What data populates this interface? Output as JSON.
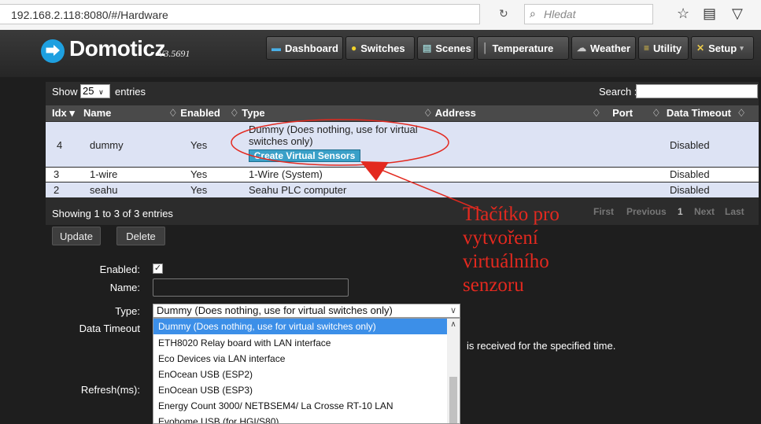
{
  "browser": {
    "url": "192.168.2.118:8080/#/Hardware",
    "reload_icon": "↻",
    "search_placeholder": "Hledat",
    "icons": [
      "reload-icon",
      "search-icon",
      "bookmark-star-icon",
      "reading-list-icon",
      "pocket-icon"
    ]
  },
  "app": {
    "logo_name": "Domoticz",
    "version": "V3.5691",
    "nav": [
      {
        "label": "Dashboard",
        "icon": "monitor-icon"
      },
      {
        "label": "Switches",
        "icon": "bulb-icon"
      },
      {
        "label": "Scenes",
        "icon": "scene-icon"
      },
      {
        "label": "Temperature",
        "icon": "thermometer-icon"
      },
      {
        "label": "Weather",
        "icon": "cloud-icon"
      },
      {
        "label": "Utility",
        "icon": "utility-icon"
      },
      {
        "label": "Setup",
        "icon": "tools-icon"
      }
    ]
  },
  "table": {
    "show_label": "Show",
    "entries_value": "25",
    "entries_label": "entries",
    "search_label": "Search :",
    "headers": {
      "idx": "Idx",
      "name": "Name",
      "enabled": "Enabled",
      "type": "Type",
      "address": "Address",
      "port": "Port",
      "data_timeout": "Data Timeout"
    },
    "rows": [
      {
        "idx": "4",
        "name": "dummy",
        "enabled": "Yes",
        "type": "Dummy (Does nothing, use for virtual switches only)",
        "timeout": "Disabled",
        "action": "Create Virtual Sensors"
      },
      {
        "idx": "3",
        "name": "1-wire",
        "enabled": "Yes",
        "type": "1-Wire (System)",
        "timeout": "Disabled"
      },
      {
        "idx": "2",
        "name": "seahu",
        "enabled": "Yes",
        "type": "Seahu PLC computer",
        "timeout": "Disabled"
      }
    ],
    "info": "Showing 1 to 3 of 3 entries",
    "pagination": {
      "first": "First",
      "previous": "Previous",
      "page": "1",
      "next": "Next",
      "last": "Last"
    }
  },
  "form": {
    "update_label": "Update",
    "delete_label": "Delete",
    "enabled_label": "Enabled:",
    "enabled_checked": true,
    "name_label": "Name:",
    "name_value": "",
    "type_label": "Type:",
    "type_value": "Dummy (Does nothing, use for virtual switches only)",
    "data_timeout_label": "Data Timeout",
    "timeout_help": "is received for the specified time.",
    "refresh_label": "Refresh(ms):",
    "type_options": [
      "Dummy (Does nothing, use for virtual switches only)",
      "ETH8020 Relay board with LAN interface",
      "Eco Devices via LAN interface",
      "EnOcean USB (ESP2)",
      "EnOcean USB (ESP3)",
      "Energy Count 3000/ NETBSEM4/ La Crosse RT-10 LAN",
      "Evohome USB (for HGI/S80)"
    ]
  },
  "annotation": {
    "lines": [
      "Tlačítko pro",
      "vytvoření",
      "virtuálního",
      "senzoru"
    ]
  },
  "colors": {
    "annotation_red": "#e3291f",
    "selected_option_bg": "#3c8fe8",
    "create_button_bg": "#3aa0c8",
    "row_bg": "#dde3f4"
  }
}
